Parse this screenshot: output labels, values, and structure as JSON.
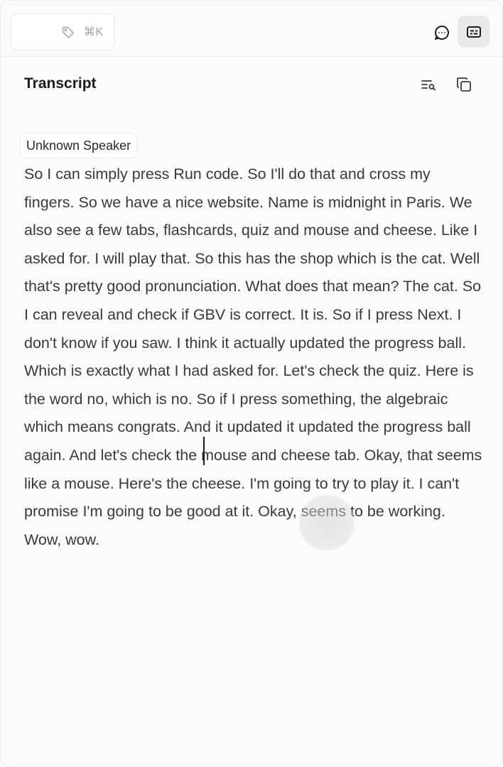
{
  "toolbar": {
    "shortcut": "⌘K",
    "icons": {
      "tag": "tag-icon",
      "chat": "chat-bubble-icon",
      "transcript": "transcript-panel-icon"
    }
  },
  "panel": {
    "title": "Transcript",
    "icons": {
      "search": "search-transcript-icon",
      "copy": "copy-icon"
    }
  },
  "segments": [
    {
      "speaker": "Unknown Speaker",
      "text": "So I can simply press Run code. So I'll do that and cross my fingers. So we have a nice website. Name is midnight in Paris. We also see a few tabs, flashcards, quiz and mouse and cheese. Like I asked for. I will play that. So this has the shop which is the cat. Well that's pretty good pronunciation. What does that mean? The cat. So I can reveal and check if GBV is correct. It is. So if I press Next. I don't know if you saw. I think it actually updated the progress ball. Which is exactly what I had asked for. Let's check the quiz. Here is the word no, which is no. So if I press something, the algebraic which means congrats. And it updated it updated the progress ball again. And let's check the mouse and cheese tab. Okay, that seems like a mouse. Here's the cheese. I'm going to try to play it. I can't promise I'm going to be good at it. Okay, seems to be working. Wow, wow."
    }
  ],
  "colors": {
    "background": "#fbfbfb",
    "text": "#3a3a3a",
    "title": "#1c1c1c",
    "muted": "#a0a0a0",
    "active_toggle": "#e9e9e9"
  }
}
